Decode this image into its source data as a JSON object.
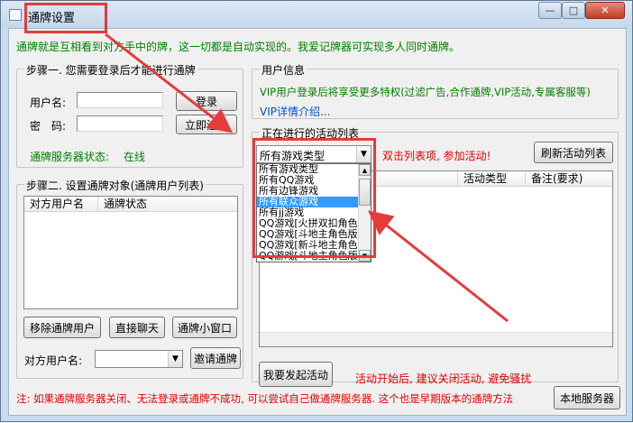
{
  "window": {
    "title": "通牌设置",
    "minimize_glyph": "—",
    "maximize_glyph": "□",
    "close_glyph": "✕",
    "app_icon": "window-app-icon"
  },
  "intro_text": "通牌就是互相看到对方手中的牌，这一切都是自动实现的。我爱记牌器可实现多人同时通牌。",
  "step1": {
    "title": "步骤一. 您需要登录后才能进行通牌",
    "username_label": "用户名:",
    "username_value": "",
    "password_label": "密　码:",
    "password_value": "",
    "login_button": "登录",
    "register_button": "立即注册",
    "server_status_label": "通牌服务器状态:",
    "server_status_value": "在线"
  },
  "user_info": {
    "title": "用户信息",
    "vip_text": "VIP用户登录后将享受更多特权(过滤广告,合作通牌,VIP活动,专属客服等)",
    "vip_link": "VIP详情介绍..."
  },
  "step2": {
    "title": "步骤二. 设置通牌对象(通牌用户列表)",
    "columns": [
      "对方用户名",
      "通牌状态"
    ],
    "rows": [],
    "remove_button": "移除通牌用户",
    "chat_button": "直接聊天",
    "mini_window_button": "通牌小窗口",
    "target_label": "对方用户名:",
    "target_value": "",
    "invite_button": "邀请通牌"
  },
  "activities": {
    "title": "正在进行的活动列表",
    "selected_type": "所有游戏类型",
    "options": [
      "所有游戏类型",
      "所有QQ游戏",
      "所有边锋游戏",
      "所有联众游戏",
      "所有jj游戏",
      "QQ游戏[火拼双扣角色",
      "QQ游戏[斗地主角色版",
      "QQ游戏[新斗地主角色",
      "QQ游戏[斗地主角色版"
    ],
    "highlighted_index": 3,
    "hint": "双击列表项, 参加活动!",
    "refresh_button": "刷新活动列表",
    "columns": [
      "",
      "活动类型",
      "备注(要求)"
    ],
    "rows": [],
    "start_button": "我要发起活动",
    "start_hint": "活动开始后, 建议关闭活动, 避免骚扰"
  },
  "footer": {
    "note": "注: 如果通牌服务器关闭、无法登录或通牌不成功, 可以尝试自己做通牌服务器. 这个也是早期版本的通牌方法",
    "local_server_button": "本地服务器"
  },
  "colors": {
    "annotation": "#e53b3b",
    "hint_red": "#e00000",
    "status_green": "#008000",
    "link_blue": "#0050c8",
    "selection": "#3399ff"
  }
}
